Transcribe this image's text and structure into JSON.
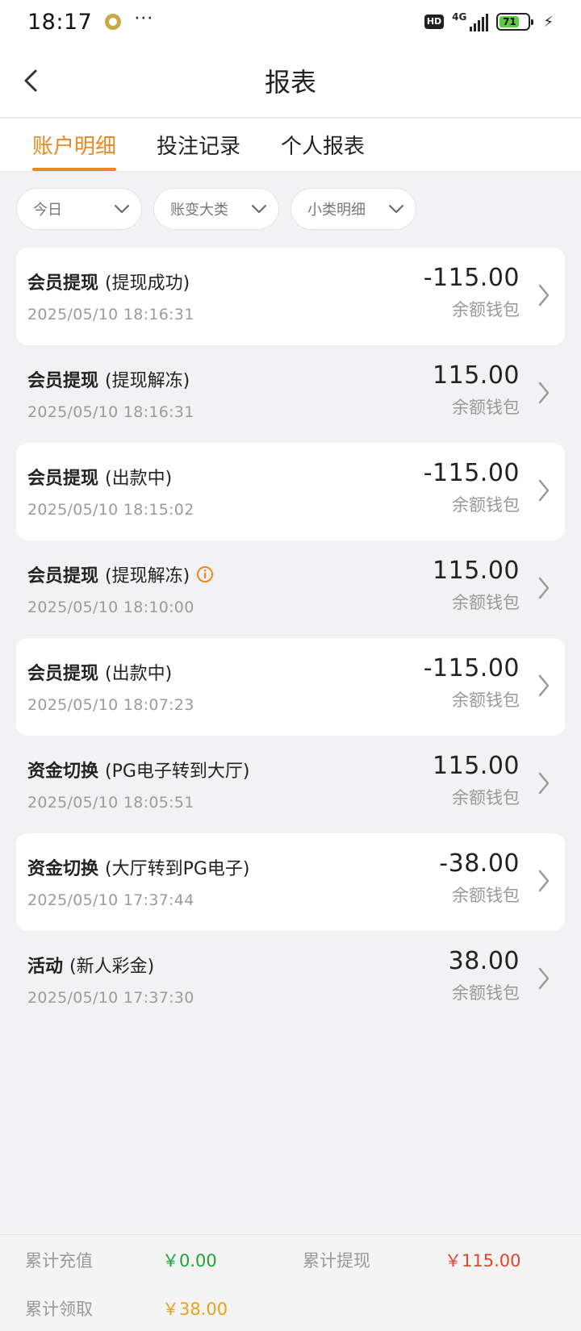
{
  "status_bar": {
    "time": "18:17",
    "dots": "···",
    "hd": "HD",
    "network": "4G",
    "battery": "71"
  },
  "header": {
    "title": "报表",
    "back_icon": "chevron-left-icon"
  },
  "tabs": [
    {
      "label": "账户明细",
      "active": true
    },
    {
      "label": "投注记录",
      "active": false
    },
    {
      "label": "个人报表",
      "active": false
    }
  ],
  "filters": [
    {
      "label": "今日"
    },
    {
      "label": "账变大类"
    },
    {
      "label": "小类明细"
    }
  ],
  "records": [
    {
      "category": "会员提现",
      "detail": "(提现成功)",
      "time": "2025/05/10 18:16:31",
      "amount": "-115.00",
      "wallet": "余额钱包"
    },
    {
      "category": "会员提现",
      "detail": "(提现解冻)",
      "time": "2025/05/10 18:16:31",
      "amount": "115.00",
      "wallet": "余额钱包"
    },
    {
      "category": "会员提现",
      "detail": "(出款中)",
      "time": "2025/05/10 18:15:02",
      "amount": "-115.00",
      "wallet": "余额钱包"
    },
    {
      "category": "会员提现",
      "detail": "(提现解冻)",
      "time": "2025/05/10 18:10:00",
      "amount": "115.00",
      "wallet": "余额钱包"
    },
    {
      "category": "会员提现",
      "detail": "(出款中)",
      "time": "2025/05/10 18:07:23",
      "amount": "-115.00",
      "wallet": "余额钱包"
    },
    {
      "category": "资金切换",
      "detail": "(PG电子转到大厅)",
      "time": "2025/05/10 18:05:51",
      "amount": "115.00",
      "wallet": "余额钱包"
    },
    {
      "category": "资金切换",
      "detail": "(大厅转到PG电子)",
      "time": "2025/05/10 17:37:44",
      "amount": "-38.00",
      "wallet": "余额钱包"
    },
    {
      "category": "活动",
      "detail": "(新人彩金)",
      "time": "2025/05/10 17:37:30",
      "amount": "38.00",
      "wallet": "余额钱包"
    }
  ],
  "summary": {
    "recharge_label": "累计充值",
    "recharge_value": "￥0.00",
    "withdraw_label": "累计提现",
    "withdraw_value": "￥115.00",
    "claim_label": "累计领取",
    "claim_value": "￥38.00"
  },
  "colors": {
    "accent": "#e8891f",
    "green": "#19a637",
    "red": "#e0462a",
    "gold": "#e8a21c"
  }
}
